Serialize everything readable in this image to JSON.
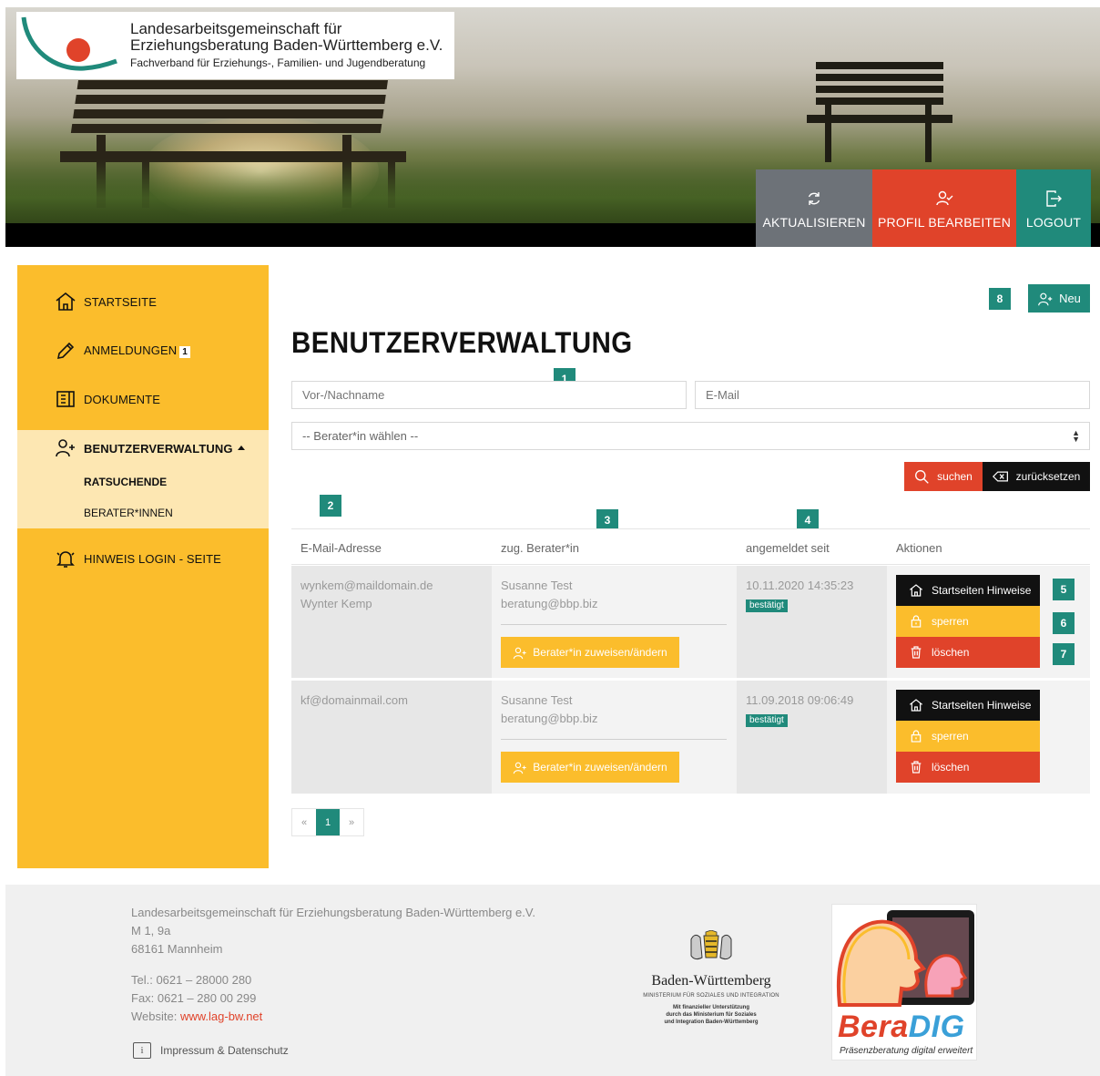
{
  "header": {
    "logo_line1": "Landesarbeitsgemeinschaft für",
    "logo_line2": "Erziehungsberatung Baden-Württemberg e.V.",
    "logo_line3": "Fachverband für Erziehungs-, Familien- und Jugendberatung",
    "buttons": {
      "refresh": "AKTUALISIEREN",
      "profile": "PROFIL BEARBEITEN",
      "logout": "LOGOUT"
    }
  },
  "sidebar": {
    "items": [
      {
        "label": "STARTSEITE",
        "icon": "home-icon"
      },
      {
        "label": "ANMELDUNGEN",
        "badge": "1",
        "icon": "pencil-icon"
      },
      {
        "label": "DOKUMENTE",
        "icon": "document-icon"
      },
      {
        "label": "BENUTZERVERWALTUNG",
        "icon": "user-plus-icon"
      },
      {
        "label": "HINWEIS LOGIN - SEITE",
        "icon": "bell-icon"
      }
    ],
    "subitems": [
      "RATSUCHENDE",
      "BERATER*INNEN"
    ]
  },
  "main": {
    "new_button": "Neu",
    "title": "BENUTZERVERWALTUNG",
    "name_placeholder": "Vor-/Nachname",
    "email_placeholder": "E-Mail",
    "select_value": "-- Berater*in wählen --",
    "search_button": "suchen",
    "reset_button": "zurücksetzen",
    "tags": [
      "1",
      "2",
      "3",
      "4",
      "5",
      "6",
      "7",
      "8"
    ]
  },
  "table": {
    "headers": [
      "E-Mail-Adresse",
      "zug. Berater*in",
      "angemeldet seit",
      "Aktionen"
    ],
    "rows": [
      {
        "email": "wynkem@maildomain.de",
        "name": "Wynter Kemp",
        "berater_name": "Susanne Test",
        "berater_email": "beratung@bbp.biz",
        "assign": "Berater*in zuweisen/ändern",
        "date": "10.11.2020 14:35:23",
        "status": "bestätigt",
        "actions": {
          "home": "Startseiten Hinweise",
          "lock": "sperren",
          "delete": "löschen"
        }
      },
      {
        "email": "kf@domainmail.com",
        "name": "",
        "berater_name": "Susanne Test",
        "berater_email": "beratung@bbp.biz",
        "assign": "Berater*in zuweisen/ändern",
        "date": "11.09.2018 09:06:49",
        "status": "bestätigt",
        "actions": {
          "home": "Startseiten Hinweise",
          "lock": "sperren",
          "delete": "löschen"
        }
      }
    ]
  },
  "pagination": {
    "prev": "«",
    "current": "1",
    "next": "»"
  },
  "footer": {
    "org": "Landesarbeitsgemeinschaft für Erziehungsberatung Baden-Württemberg e.V.",
    "street": "M 1, 9a",
    "city": "68161 Mannheim",
    "tel": "Tel.: 0621 – 28000 280",
    "fax": "Fax: 0621 – 280 00 299",
    "website_label": "Website: ",
    "website": "www.lag-bw.net",
    "impressum": "Impressum & Datenschutz",
    "bw_name": "Baden-Württemberg",
    "bw_ministry": "MINISTERIUM FÜR SOZIALES UND INTEGRATION",
    "bw_fin1": "Mit finanzieller Unterstützung",
    "bw_fin2": "durch das Ministerium für Soziales",
    "bw_fin3": "und Integration Baden-Württemberg",
    "beradig_bera": "Bera",
    "beradig_dig": "DIG",
    "beradig_sub": "Präsenzberatung digital erweitert"
  },
  "colors": {
    "yellow": "#fbbd2c",
    "red": "#e0432a",
    "teal": "#208a7b",
    "grey": "#6d7278"
  }
}
